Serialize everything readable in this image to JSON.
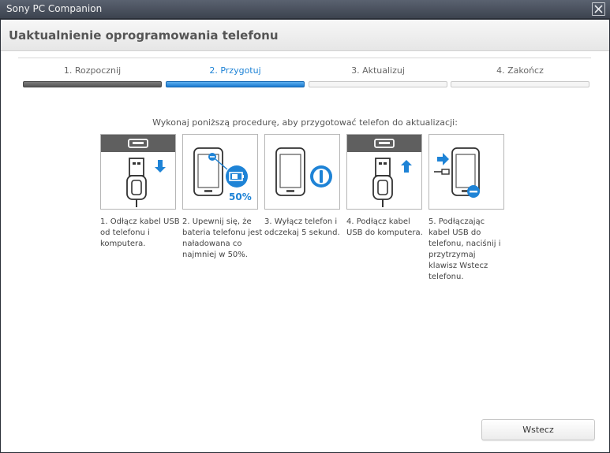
{
  "window": {
    "app_title": "Sony PC Companion",
    "heading": "Uaktualnienie oprogramowania telefonu"
  },
  "steps": [
    {
      "label": "1. Rozpocznij",
      "state": "done"
    },
    {
      "label": "2. Przygotuj",
      "state": "active"
    },
    {
      "label": "3. Aktualizuj",
      "state": "pending"
    },
    {
      "label": "4. Zakończ",
      "state": "pending"
    }
  ],
  "instruction": "Wykonaj poniższą procedurę, aby przygotować telefon do aktualizacji:",
  "procedure": [
    {
      "icon": "usb-unplug-from-computer-icon",
      "text": "1. Odłącz kabel USB od telefonu i komputera."
    },
    {
      "icon": "phone-battery-icon",
      "badge": "50%",
      "text": "2. Upewnij się, że bateria telefonu jest naładowana co najmniej w 50%."
    },
    {
      "icon": "phone-power-off-icon",
      "text": "3. Wyłącz telefon i odczekaj 5 sekund."
    },
    {
      "icon": "usb-plug-into-computer-icon",
      "text": "4. Podłącz kabel USB do komputera."
    },
    {
      "icon": "phone-connect-back-key-icon",
      "text": "5. Podłączając kabel USB do telefonu, naciśnij i przytrzymaj klawisz Wstecz telefonu."
    }
  ],
  "buttons": {
    "back": "Wstecz"
  },
  "colors": {
    "accent": "#1e83d6",
    "done": "#5a5a5a"
  }
}
